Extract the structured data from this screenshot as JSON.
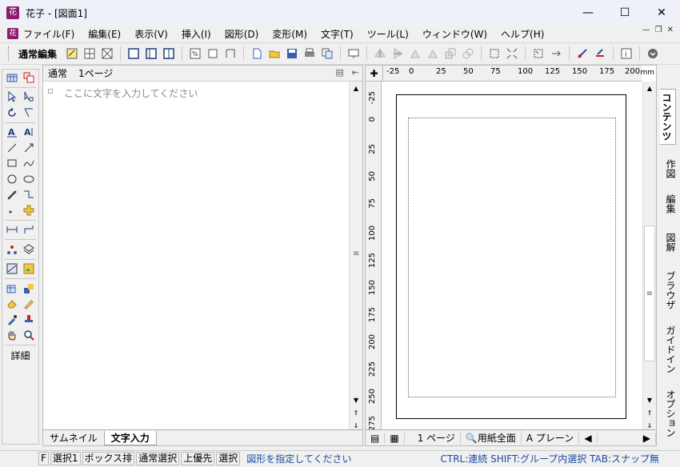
{
  "window": {
    "title": "花子 - [図面1]",
    "icon": "花"
  },
  "menubar": {
    "items": [
      "ファイル(F)",
      "編集(E)",
      "表示(V)",
      "挿入(I)",
      "図形(D)",
      "変形(M)",
      "文字(T)",
      "ツール(L)",
      "ウィンドウ(W)",
      "ヘルプ(H)"
    ]
  },
  "toolbar": {
    "label": "通常編集"
  },
  "textpane": {
    "mode": "通常",
    "page": "1ページ",
    "placeholder": "ここに文字を入力してください",
    "tabs": [
      "サムネイル",
      "文字入力"
    ]
  },
  "ruler": {
    "h_ticks": [
      "-25",
      "0",
      "25",
      "50",
      "75",
      "100",
      "125",
      "150",
      "175",
      "200"
    ],
    "unit": "mm",
    "v_ticks": [
      "-25",
      "0",
      "25",
      "50",
      "75",
      "100",
      "125",
      "150",
      "175",
      "200",
      "225",
      "250",
      "275"
    ]
  },
  "drawbottom": {
    "page": "1 ページ",
    "zoom": "用紙全面",
    "layer": "A プレーン"
  },
  "sidetabs": [
    "コンテンツ",
    "作図",
    "編集",
    "図解",
    "ブラウザ",
    "ガイドイン",
    "オプション"
  ],
  "toolbox": {
    "detail": "詳細"
  },
  "status": {
    "cells": [
      "F",
      "選択1",
      "ボックス排",
      "通常選択",
      "上優先",
      "選択"
    ],
    "hint": "図形を指定してください",
    "right": "CTRL:連続 SHIFT:グループ内選択 TAB:スナップ無"
  }
}
